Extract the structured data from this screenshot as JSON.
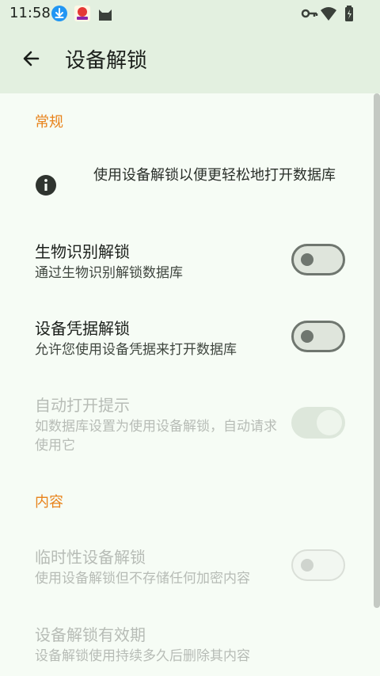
{
  "status_bar": {
    "time": "11:58",
    "icons": [
      "download-icon",
      "app-notification-icon",
      "cat-app-icon",
      "vpn-key-icon",
      "wifi-icon",
      "battery-icon"
    ]
  },
  "app_bar": {
    "title": "设备解锁",
    "back_icon": "arrow-back-icon"
  },
  "sections": {
    "general": {
      "label": "常规"
    },
    "content": {
      "label": "内容"
    }
  },
  "info": {
    "icon": "info-icon",
    "text": "使用设备解锁以便更轻松地打开数据库"
  },
  "prefs": {
    "biometric": {
      "title": "生物识别解锁",
      "summary": "通过生物识别解锁数据库",
      "state": "off",
      "enabled": true
    },
    "credential": {
      "title": "设备凭据解锁",
      "summary": "允许您使用设备凭据来打开数据库",
      "state": "off",
      "enabled": true
    },
    "auto_prompt": {
      "title": "自动打开提示",
      "summary": "如数据库设置为使用设备解锁，自动请求使用它",
      "state": "on",
      "enabled": false
    },
    "temporary": {
      "title": "临时性设备解锁",
      "summary": "使用设备解锁但不存储任何加密内容",
      "state": "off",
      "enabled": false
    },
    "expiration": {
      "title": "设备解锁有效期",
      "summary": "设备解锁使用持续多久后删除其内容",
      "enabled": false
    }
  },
  "colors": {
    "accent": "#e8821a",
    "app_bar": "#e3f0e0",
    "background": "#f6fcf5"
  }
}
